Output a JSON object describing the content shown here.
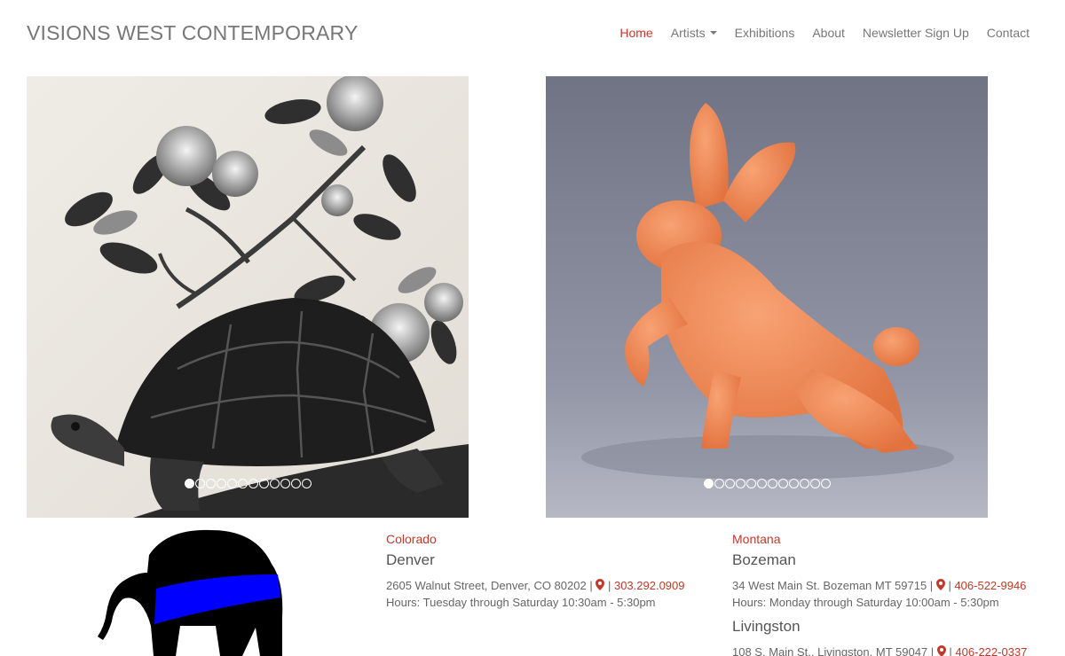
{
  "header": {
    "brand": "VISIONS WEST CONTEMPORARY",
    "nav": [
      "Home",
      "Artists",
      "Exhibitions",
      "About",
      "Newsletter Sign Up",
      "Contact"
    ],
    "active_nav": "Home",
    "accent_color": "#c0392b"
  },
  "slider_left": {
    "dot_count": 12,
    "active_dot": 1,
    "subject": "turtle-with-blossoms-painting"
  },
  "slider_right": {
    "dot_count": 12,
    "active_dot": 1,
    "subject": "orange-knitted-hare-sculpture"
  },
  "logo": {
    "subject": "elephant-with-blue-band-icon",
    "band_color": "#0000ff"
  },
  "colorado": {
    "state": "Colorado",
    "city": "Denver",
    "address": "2605 Walnut Street, Denver, CO 80202 |",
    "sep": "|",
    "phone": "303.292.0909",
    "hours": "Hours: Tuesday through Saturday 10:30am - 5:30pm"
  },
  "montana": {
    "state": "Montana",
    "city": "Bozeman",
    "address": "34 West Main St. Bozeman MT 59715 |",
    "sep": "|",
    "phone": "406-522-9946",
    "hours": "Hours: Monday through Saturday 10:00am - 5:30pm",
    "city2": "Livingston",
    "address2": "108 S. Main St., Livingston, MT 59047 |",
    "phone2": "406-222-0337"
  }
}
